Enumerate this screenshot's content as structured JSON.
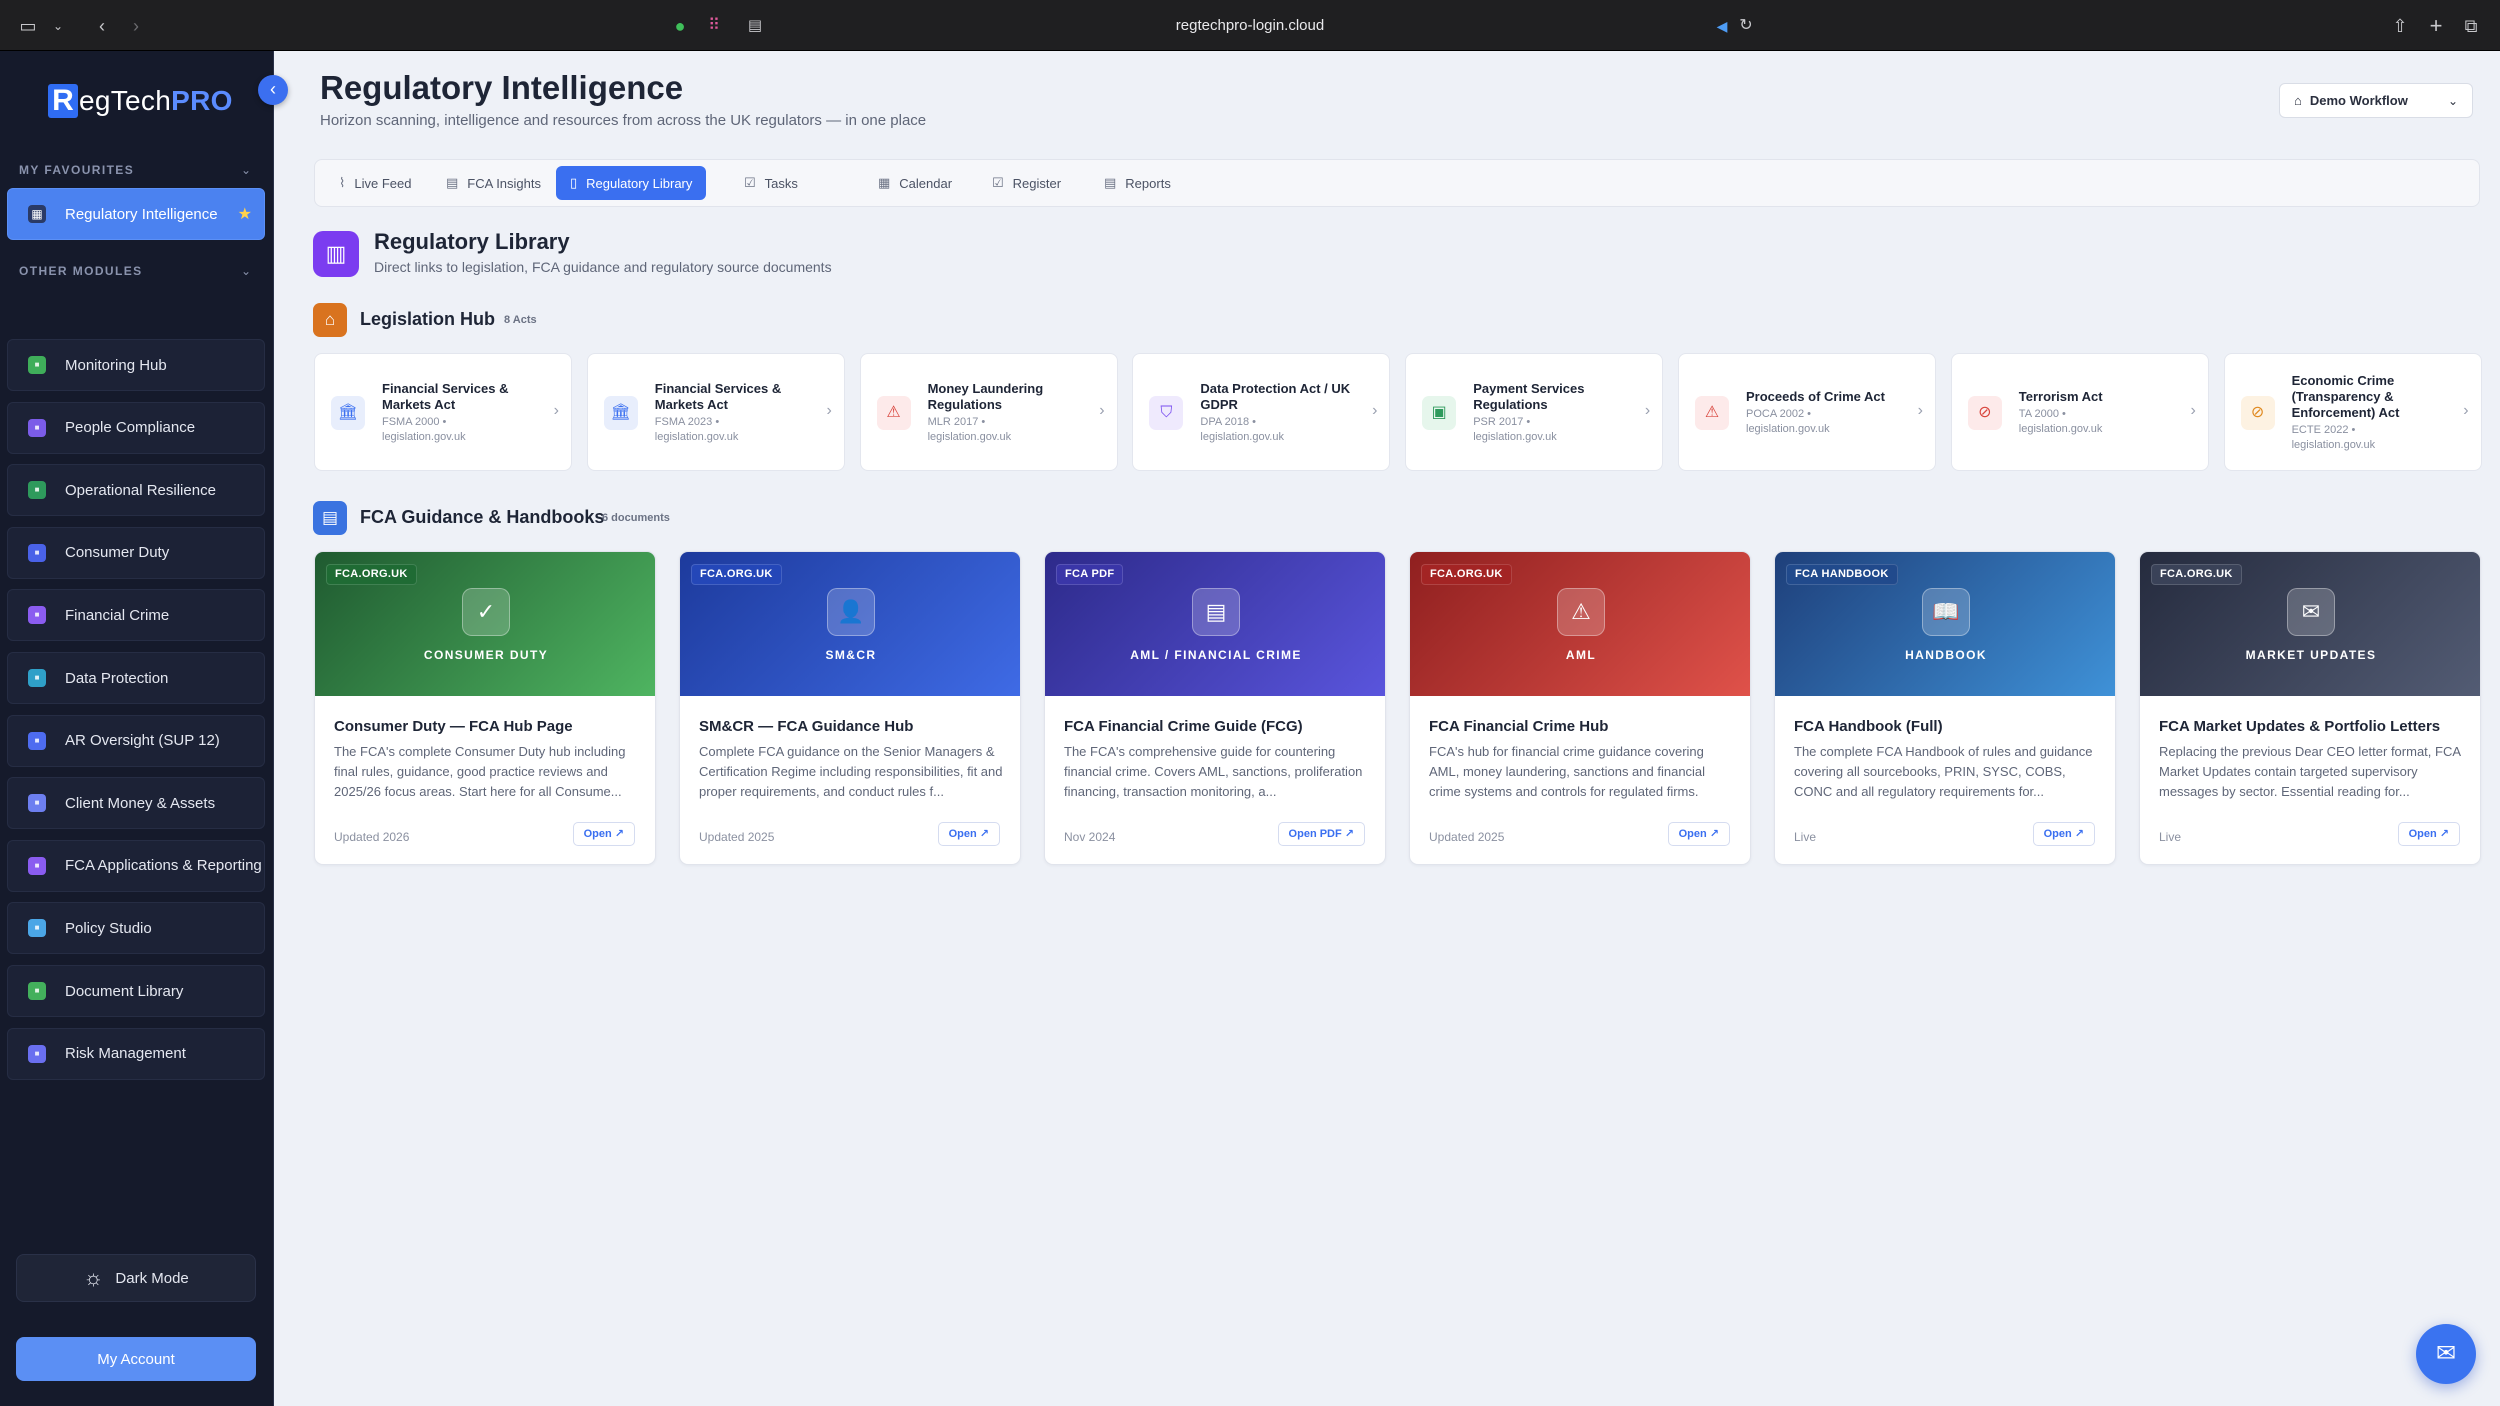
{
  "browser": {
    "url": "regtechpro-login.cloud"
  },
  "brand": {
    "letter": "R",
    "name_a": "egTech",
    "name_b": "PRO"
  },
  "sidebar": {
    "favourites_label": "MY FAVOURITES",
    "other_label": "OTHER MODULES",
    "favourites": [
      {
        "label": "Regulatory Intelligence",
        "icon": "dashboard-icon",
        "active": true
      }
    ],
    "modules": [
      {
        "label": "Monitoring Hub",
        "icon": "monitor-icon",
        "color": "#3fae5a"
      },
      {
        "label": "People Compliance",
        "icon": "people-icon",
        "color": "#7b5ce8"
      },
      {
        "label": "Operational Resilience",
        "icon": "shield-icon",
        "color": "#2e9a5c"
      },
      {
        "label": "Consumer Duty",
        "icon": "target-icon",
        "color": "#4a62e8"
      },
      {
        "label": "Financial Crime",
        "icon": "lock-icon",
        "color": "#8b5cf0"
      },
      {
        "label": "Data Protection",
        "icon": "data-shield-icon",
        "color": "#2fa0c8"
      },
      {
        "label": "AR Oversight (SUP 12)",
        "icon": "network-icon",
        "color": "#4e6cf0"
      },
      {
        "label": "Client Money & Assets",
        "icon": "bank-icon",
        "color": "#6d7ff0"
      },
      {
        "label": "FCA Applications & Reporting",
        "icon": "form-icon",
        "color": "#8a5cf0"
      },
      {
        "label": "Policy Studio",
        "icon": "policy-icon",
        "color": "#4ba6e6"
      },
      {
        "label": "Document Library",
        "icon": "folder-icon",
        "color": "#43b05c"
      },
      {
        "label": "Risk Management",
        "icon": "risk-shield-icon",
        "color": "#6a6ff0"
      }
    ],
    "dark_mode": "Dark Mode",
    "my_account": "My Account"
  },
  "header": {
    "title": "Regulatory Intelligence",
    "subtitle": "Horizon scanning, intelligence and resources from across the UK regulators — in one place",
    "workflow": "Demo Workflow"
  },
  "tabs": [
    {
      "label": "Live Feed",
      "icon": "rss-icon",
      "glyph": "⌇"
    },
    {
      "label": "FCA Insights",
      "icon": "insights-icon",
      "glyph": "▤"
    },
    {
      "label": "Regulatory Library",
      "icon": "book-icon",
      "glyph": "▯",
      "active": true
    },
    {
      "label": "Tasks",
      "icon": "tasks-icon",
      "glyph": "☑"
    },
    {
      "label": "Calendar",
      "icon": "calendar-icon",
      "glyph": "▦"
    },
    {
      "label": "Register",
      "icon": "register-icon",
      "glyph": "☑"
    },
    {
      "label": "Reports",
      "icon": "report-icon",
      "glyph": "▤"
    }
  ],
  "library": {
    "title": "Regulatory Library",
    "subtitle": "Direct links to legislation, FCA guidance and regulatory source documents"
  },
  "legislation": {
    "title": "Legislation Hub",
    "count": "8 Acts",
    "acts": [
      {
        "name": "Financial Services & Markets Act",
        "meta": "FSMA 2000 •",
        "source": "legislation.gov.uk",
        "icon": "bank-icon",
        "glyph": "🏛",
        "bg": "#e8eefc",
        "fg": "#3a6ff0"
      },
      {
        "name": "Financial Services & Markets Act",
        "meta": "FSMA 2023 •",
        "source": "legislation.gov.uk",
        "icon": "bank-icon",
        "glyph": "🏛",
        "bg": "#e8eefc",
        "fg": "#3a6ff0"
      },
      {
        "name": "Money Laundering Regulations",
        "meta": "MLR 2017 •",
        "source": "legislation.gov.uk",
        "icon": "warning-icon",
        "glyph": "⚠",
        "bg": "#fdeaea",
        "fg": "#d9453d"
      },
      {
        "name": "Data Protection Act / UK GDPR",
        "meta": "DPA 2018 •",
        "source": "legislation.gov.uk",
        "icon": "shield-check-icon",
        "glyph": "⛉",
        "bg": "#efeafd",
        "fg": "#7a4ef0"
      },
      {
        "name": "Payment Services Regulations",
        "meta": "PSR 2017 •",
        "source": "legislation.gov.uk",
        "icon": "banknote-icon",
        "glyph": "▣",
        "bg": "#e6f6ec",
        "fg": "#2e9a5c"
      },
      {
        "name": "Proceeds of Crime Act",
        "meta": "POCA 2002 •",
        "source": "legislation.gov.uk",
        "icon": "warning-icon",
        "glyph": "⚠",
        "bg": "#fdeaea",
        "fg": "#d9453d"
      },
      {
        "name": "Terrorism Act",
        "meta": "TA 2000 •",
        "source": "legislation.gov.uk",
        "icon": "eye-off-icon",
        "glyph": "⊘",
        "bg": "#fdeaea",
        "fg": "#d9453d"
      },
      {
        "name": "Economic Crime (Transparency & Enforcement) Act",
        "meta": "ECTE 2022 •",
        "source": "legislation.gov.uk",
        "icon": "eye-off-icon",
        "glyph": "⊘",
        "bg": "#fdf2e2",
        "fg": "#e08a20"
      }
    ]
  },
  "guidance": {
    "title": "FCA Guidance & Handbooks",
    "count": "6 documents",
    "cards": [
      {
        "tag": "FCA.ORG.UK",
        "banner_label": "CONSUMER DUTY",
        "icon": "check-circle-icon",
        "glyph": "✓",
        "title": "Consumer Duty — FCA Hub Page",
        "desc": "The FCA's complete Consumer Duty hub including final rules, guidance, good practice reviews and 2025/26 focus areas. Start here for all Consume...",
        "date": "Updated 2026",
        "open": "Open",
        "c1": "#1f5a30",
        "c2": "#4fb561",
        "tagbg": "#1f6b34"
      },
      {
        "tag": "FCA.ORG.UK",
        "banner_label": "SM&CR",
        "icon": "person-icon",
        "glyph": "👤",
        "title": "SM&CR — FCA Guidance Hub",
        "desc": "Complete FCA guidance on the Senior Managers & Certification Regime including responsibilities, fit and proper requirements, and conduct rules f...",
        "date": "Updated 2025",
        "open": "Open",
        "c1": "#1d3a9c",
        "c2": "#3f6be6",
        "tagbg": "#2447b8"
      },
      {
        "tag": "FCA PDF",
        "banner_label": "AML / FINANCIAL CRIME",
        "icon": "document-icon",
        "glyph": "▤",
        "title": "FCA Financial Crime Guide (FCG)",
        "desc": "The FCA's comprehensive guide for countering financial crime. Covers AML, sanctions, proliferation financing, transaction monitoring, a...",
        "date": "Nov 2024",
        "open": "Open PDF",
        "c1": "#2d2a8a",
        "c2": "#5a55dd",
        "tagbg": "#3a36a8"
      },
      {
        "tag": "FCA.ORG.UK",
        "banner_label": "AML",
        "icon": "warning-icon",
        "glyph": "⚠",
        "title": "FCA Financial Crime Hub",
        "desc": "FCA's hub for financial crime guidance covering AML, money laundering, sanctions and financial crime systems and controls for regulated firms.",
        "date": "Updated 2025",
        "open": "Open",
        "c1": "#8f1f1f",
        "c2": "#e0524a",
        "tagbg": "#a32424"
      },
      {
        "tag": "FCA HANDBOOK",
        "banner_label": "HANDBOOK",
        "icon": "open-book-icon",
        "glyph": "📖",
        "title": "FCA Handbook (Full)",
        "desc": "The complete FCA Handbook of rules and guidance covering all sourcebooks, PRIN, SYSC, COBS, CONC and all regulatory requirements for...",
        "date": "Live",
        "open": "Open",
        "c1": "#1e3f7a",
        "c2": "#3f92d8",
        "tagbg": "#214a8c"
      },
      {
        "tag": "FCA.ORG.UK",
        "banner_label": "MARKET UPDATES",
        "icon": "mail-open-icon",
        "glyph": "✉",
        "title": "FCA Market Updates & Portfolio Letters",
        "desc": "Replacing the previous Dear CEO letter format, FCA Market Updates contain targeted supervisory messages by sector. Essential reading for...",
        "date": "Live",
        "open": "Open",
        "c1": "#252b3e",
        "c2": "#535c74",
        "tagbg": "#3a4258"
      }
    ]
  }
}
